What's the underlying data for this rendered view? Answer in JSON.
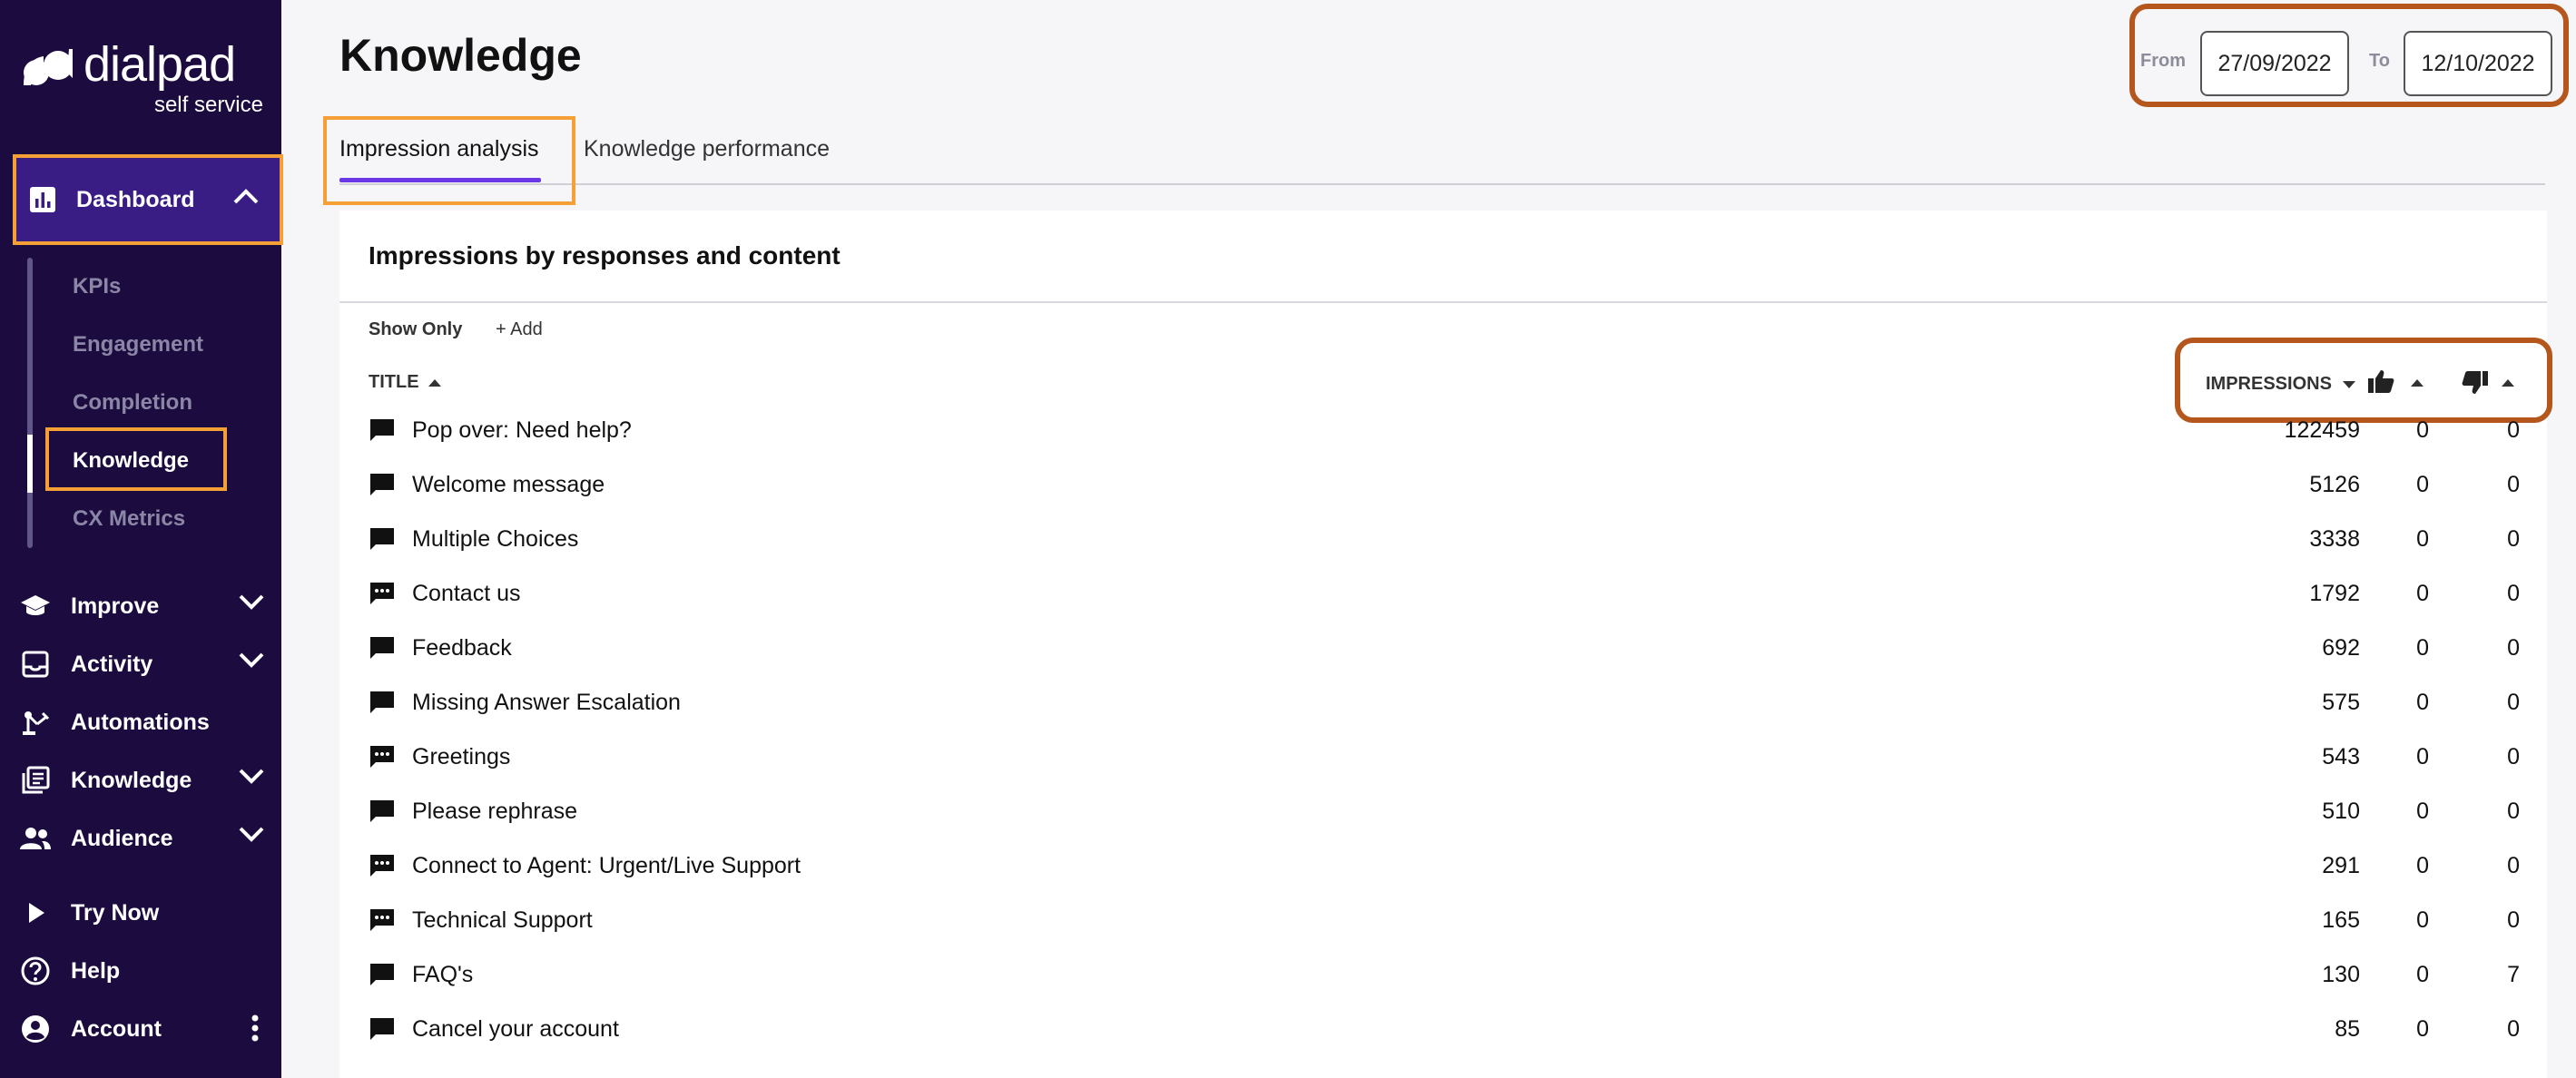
{
  "brand": {
    "name": "dialpad",
    "subtitle": "self service"
  },
  "sidebar": {
    "dashboard_label": "Dashboard",
    "sub_items": [
      "KPIs",
      "Engagement",
      "Completion",
      "Knowledge",
      "CX Metrics"
    ],
    "items": [
      {
        "label": "Improve",
        "icon": "graduation-cap-icon",
        "expandable": true
      },
      {
        "label": "Activity",
        "icon": "inbox-icon",
        "expandable": true
      },
      {
        "label": "Automations",
        "icon": "robot-arm-icon",
        "expandable": false
      },
      {
        "label": "Knowledge",
        "icon": "library-icon",
        "expandable": true
      },
      {
        "label": "Audience",
        "icon": "people-icon",
        "expandable": true
      },
      {
        "label": "Try Now",
        "icon": "play-icon",
        "expandable": false
      },
      {
        "label": "Help",
        "icon": "help-circle-icon",
        "expandable": false
      },
      {
        "label": "Account",
        "icon": "account-circle-icon",
        "expandable": false
      }
    ]
  },
  "header": {
    "title": "Knowledge",
    "from_label": "From",
    "from_value": "27/09/2022",
    "to_label": "To",
    "to_value": "12/10/2022"
  },
  "tabs": [
    {
      "label": "Impression analysis",
      "active": true
    },
    {
      "label": "Knowledge performance",
      "active": false
    }
  ],
  "card": {
    "title": "Impressions by responses and content",
    "show_only": "Show Only",
    "add": "+ Add",
    "col_title": "TITLE",
    "col_impressions": "IMPRESSIONS"
  },
  "rows": [
    {
      "title": "Pop over: Need help?",
      "impressions": "122459",
      "up": "0",
      "down": "0",
      "icon": "chat-bubble-icon"
    },
    {
      "title": "Welcome message",
      "impressions": "5126",
      "up": "0",
      "down": "0",
      "icon": "chat-bubble-icon"
    },
    {
      "title": "Multiple Choices",
      "impressions": "3338",
      "up": "0",
      "down": "0",
      "icon": "chat-bubble-icon"
    },
    {
      "title": "Contact us",
      "impressions": "1792",
      "up": "0",
      "down": "0",
      "icon": "chat-dots-icon"
    },
    {
      "title": "Feedback",
      "impressions": "692",
      "up": "0",
      "down": "0",
      "icon": "chat-bubble-icon"
    },
    {
      "title": "Missing Answer Escalation",
      "impressions": "575",
      "up": "0",
      "down": "0",
      "icon": "chat-bubble-icon"
    },
    {
      "title": "Greetings",
      "impressions": "543",
      "up": "0",
      "down": "0",
      "icon": "chat-dots-icon"
    },
    {
      "title": "Please rephrase",
      "impressions": "510",
      "up": "0",
      "down": "0",
      "icon": "chat-bubble-icon"
    },
    {
      "title": "Connect to Agent: Urgent/Live Support",
      "impressions": "291",
      "up": "0",
      "down": "0",
      "icon": "chat-dots-icon"
    },
    {
      "title": "Technical Support",
      "impressions": "165",
      "up": "0",
      "down": "0",
      "icon": "chat-dots-icon"
    },
    {
      "title": "FAQ's",
      "impressions": "130",
      "up": "0",
      "down": "7",
      "icon": "chat-bubble-icon"
    },
    {
      "title": "Cancel your account",
      "impressions": "85",
      "up": "0",
      "down": "0",
      "icon": "chat-bubble-icon"
    }
  ],
  "colors": {
    "sidebar_bg": "#1b0b3f",
    "accent": "#6a37e5",
    "highlight_orange": "#f4a037",
    "highlight_rust": "#b5561d"
  }
}
